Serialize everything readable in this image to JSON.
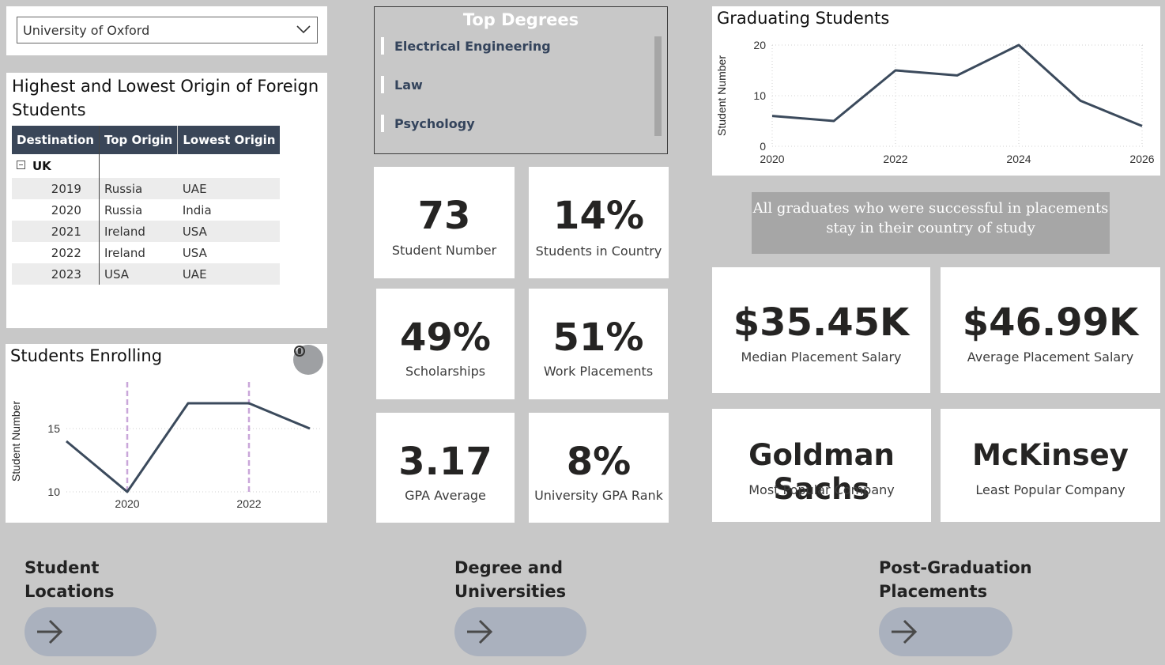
{
  "slicer": {
    "selected": "University of Oxford",
    "icon": "chevron-down-icon"
  },
  "matrix": {
    "title": "Highest and Lowest Origin of Foreign Students",
    "columns": [
      "Destination",
      "Top Origin",
      "Lowest Origin"
    ],
    "group": "UK",
    "rows": [
      {
        "year": "2019",
        "top": "Russia",
        "lowest": "UAE"
      },
      {
        "year": "2020",
        "top": "Russia",
        "lowest": "India"
      },
      {
        "year": "2021",
        "top": "Ireland",
        "lowest": "USA"
      },
      {
        "year": "2022",
        "top": "Ireland",
        "lowest": "USA"
      },
      {
        "year": "2023",
        "top": "USA",
        "lowest": "UAE"
      }
    ]
  },
  "enroll": {
    "title": "Students Enrolling",
    "ylabel": "Student Number",
    "focus_icon": "focus-mode-icon"
  },
  "degrees": {
    "title": "Top Degrees",
    "items": [
      "Electrical Engineering",
      "Law",
      "Psychology"
    ]
  },
  "kpis": {
    "student_number": {
      "value": "73",
      "label": "Student Number"
    },
    "students_in_country": {
      "value": "14%",
      "label": "Students in Country"
    },
    "scholarships": {
      "value": "49%",
      "label": "Scholarships"
    },
    "work_placements": {
      "value": "51%",
      "label": "Work Placements"
    },
    "gpa_average": {
      "value": "3.17",
      "label": "GPA Average"
    },
    "gpa_rank": {
      "value": "8%",
      "label": "University GPA Rank"
    },
    "median_salary": {
      "value": "$35.45K",
      "label": "Median Placement Salary"
    },
    "average_salary": {
      "value": "$46.99K",
      "label": "Average Placement Salary"
    },
    "most_popular": {
      "value": "Goldman Sachs",
      "label": "Most Popular Company"
    },
    "least_popular": {
      "value": "McKinsey",
      "label": "Least Popular Company"
    }
  },
  "graduating": {
    "title": "Graduating Students",
    "ylabel": "Student Number"
  },
  "note": "All graduates who were successful in placements stay in their country of study",
  "nav": [
    {
      "line1": "Student",
      "line2": "Locations",
      "icon": "arrow-right-icon"
    },
    {
      "line1": "Degree and",
      "line2": "Universities",
      "icon": "arrow-right-icon"
    },
    {
      "line1": "Post-Graduation",
      "line2": "Placements",
      "icon": "arrow-right-icon"
    }
  ],
  "colors": {
    "line": "#3b4a5c",
    "header": "#3a4658",
    "reference": "#c9a6d9",
    "button": "#aab1be"
  },
  "chart_data": [
    {
      "type": "line",
      "title": "Students Enrolling",
      "ylabel": "Student Number",
      "x": [
        2019,
        2020,
        2021,
        2022,
        2023
      ],
      "values": [
        14,
        10,
        17,
        17,
        15
      ],
      "x_tick_labels": [
        "2020",
        "2022"
      ],
      "y_tick_labels": [
        "10",
        "15"
      ],
      "ylim": [
        10,
        18
      ],
      "reference_lines_x": [
        2020,
        2022
      ],
      "grid": "horizontal-dotted"
    },
    {
      "type": "line",
      "title": "Graduating Students",
      "ylabel": "Student Number",
      "x": [
        2020,
        2021,
        2022,
        2023,
        2024,
        2025,
        2026
      ],
      "values": [
        6,
        5,
        15,
        14,
        20,
        9,
        4
      ],
      "x_tick_labels": [
        "2020",
        "2022",
        "2024",
        "2026"
      ],
      "y_tick_labels": [
        "0",
        "10",
        "20"
      ],
      "ylim": [
        0,
        20
      ],
      "grid": "dotted"
    }
  ]
}
